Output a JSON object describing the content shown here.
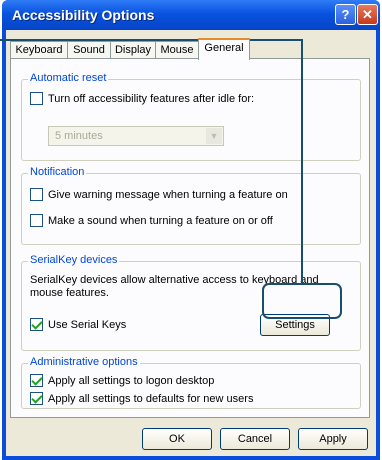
{
  "window": {
    "title": "Accessibility Options",
    "help_glyph": "?",
    "close_glyph": "✕"
  },
  "tabs": [
    {
      "label": "Keyboard"
    },
    {
      "label": "Sound"
    },
    {
      "label": "Display"
    },
    {
      "label": "Mouse"
    },
    {
      "label": "General",
      "active": true
    }
  ],
  "automatic_reset": {
    "legend": "Automatic reset",
    "checkbox_label": "Turn off accessibility features after idle for:",
    "checked": false,
    "dropdown_value": "5 minutes"
  },
  "notification": {
    "legend": "Notification",
    "items": [
      {
        "label": "Give warning message when turning a feature on",
        "checked": false
      },
      {
        "label": "Make a sound when turning a feature on or off",
        "checked": false
      }
    ]
  },
  "serialkey": {
    "legend": "SerialKey devices",
    "description": "SerialKey devices allow alternative access to keyboard and mouse features.",
    "checkbox_label": "Use Serial Keys",
    "checked": true,
    "settings_button": "Settings"
  },
  "administrative": {
    "legend": "Administrative options",
    "items": [
      {
        "label": "Apply all settings to logon desktop",
        "checked": true
      },
      {
        "label": "Apply all settings to defaults for new users",
        "checked": true
      }
    ]
  },
  "buttons": {
    "ok": "OK",
    "cancel": "Cancel",
    "apply": "Apply"
  },
  "colors": {
    "titlebar": "#0a53e0",
    "group_legend": "#0046d5",
    "callout": "#1a4e6e"
  }
}
